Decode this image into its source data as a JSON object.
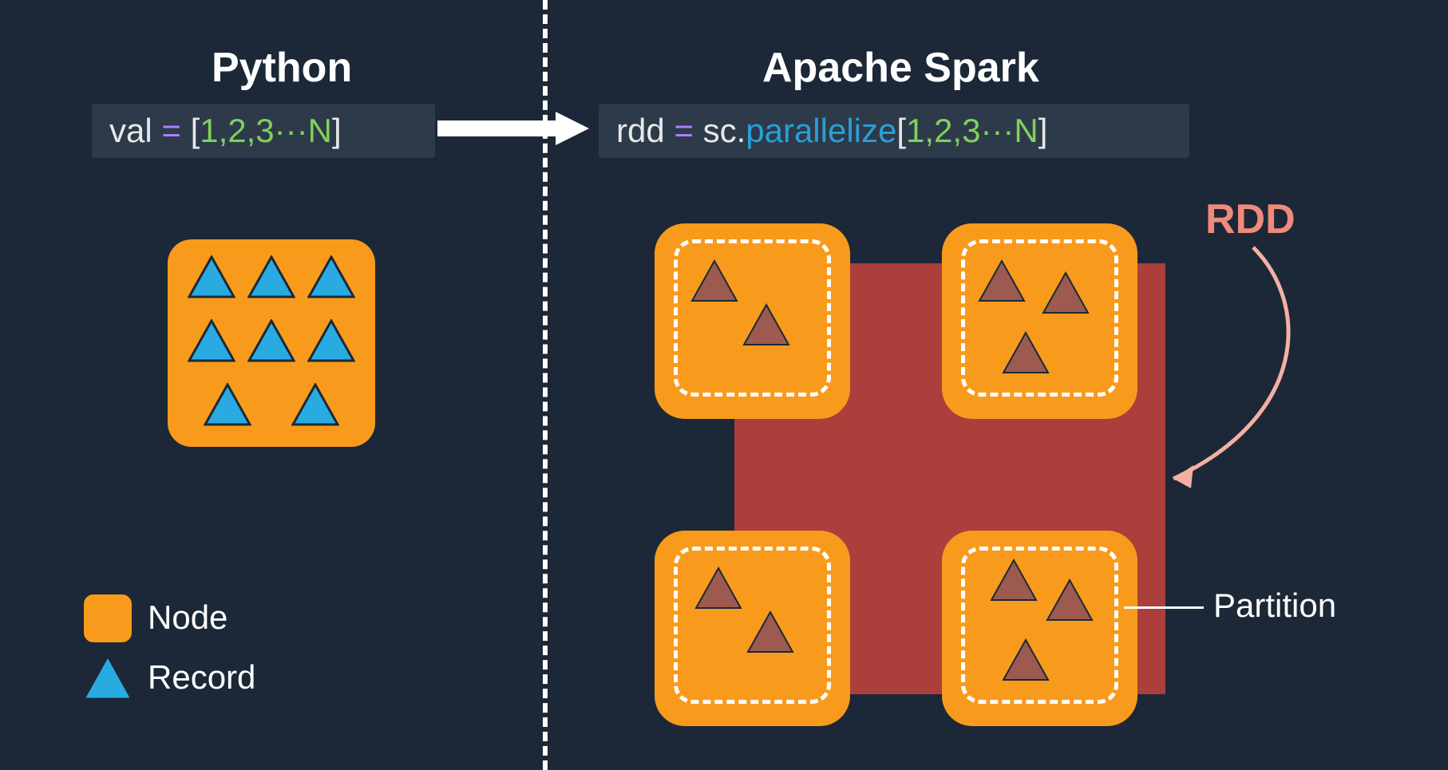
{
  "left": {
    "title": "Python",
    "code": {
      "var": "val",
      "eq": "=",
      "open": "[",
      "vals": "1,2,3···N",
      "close": "]"
    }
  },
  "right": {
    "title": "Apache Spark",
    "code": {
      "var": "rdd",
      "eq": "=",
      "obj": "sc",
      "dot": ".",
      "func": "parallelize",
      "open": "[",
      "vals": "1,2,3···N",
      "close": "]"
    },
    "rdd_label": "RDD",
    "partition_label": "Partition"
  },
  "legend": {
    "node": "Node",
    "record": "Record"
  },
  "colors": {
    "bg": "#1c2837",
    "node": "#f89b1c",
    "record_fill": "#29abe2",
    "record_stroke": "#1c2837",
    "rdd_fill": "#aa3f3c",
    "rdd_label": "#f08a7a",
    "dark_tri_fill": "#9c5a50"
  }
}
